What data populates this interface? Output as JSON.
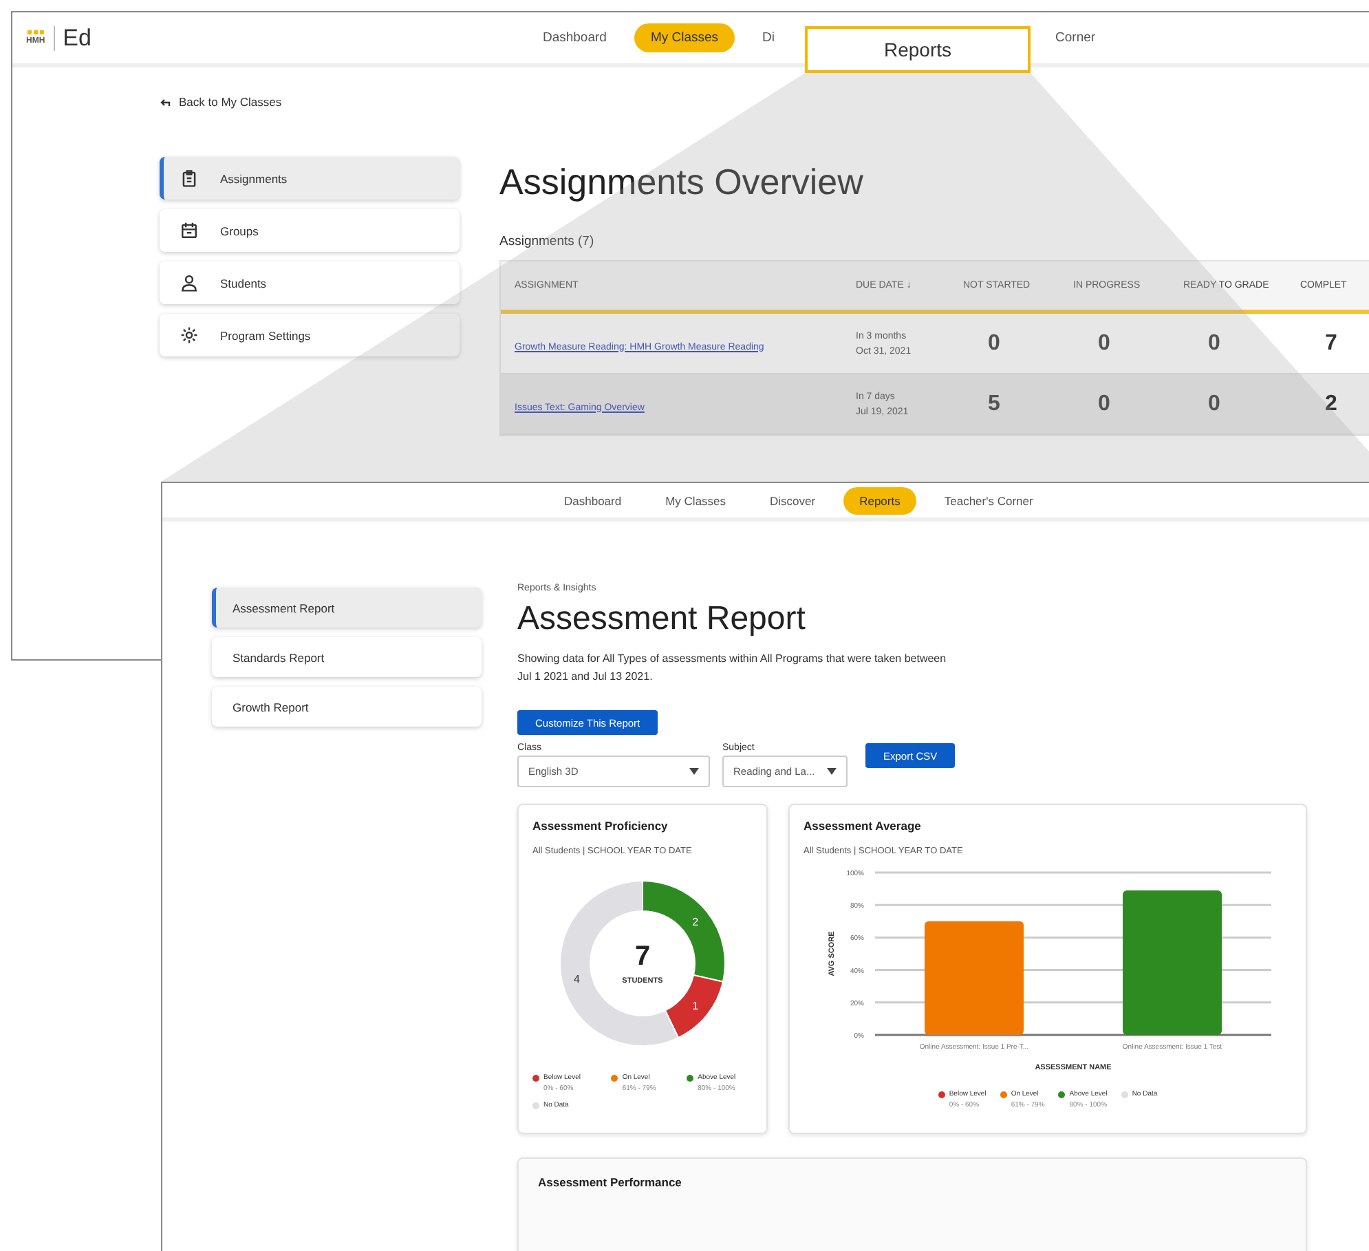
{
  "back_window": {
    "logo_mark": "HMH",
    "logo": "Ed",
    "nav": [
      {
        "label": "Dashboard",
        "selected": false
      },
      {
        "label": "My Classes",
        "selected": true
      },
      {
        "label": "Di",
        "selected": false
      },
      {
        "label": "Corner",
        "selected": false
      }
    ],
    "back_link": "Back to My Classes",
    "side_menu": [
      {
        "label": "Assignments",
        "selected": true
      },
      {
        "label": "Groups",
        "selected": false
      },
      {
        "label": "Students",
        "selected": false
      },
      {
        "label": "Program Settings",
        "selected": false
      }
    ],
    "title": "Assignments Overview",
    "subtitle": "Assignments (7)",
    "table": {
      "columns": [
        "ASSIGNMENT",
        "DUE DATE ↓",
        "NOT STARTED",
        "IN PROGRESS",
        "READY TO GRADE",
        "COMPLET"
      ],
      "rows": [
        {
          "assignment": "Growth Measure Reading: HMH Growth Measure Reading",
          "due_relative": "In 3 months",
          "due_date": "Oct 31, 2021",
          "counts": [
            "0",
            "0",
            "0",
            "7"
          ],
          "selected": false
        },
        {
          "assignment": "Issues Text: Gaming Overview",
          "due_relative": "In 7 days",
          "due_date": "Jul 19, 2021",
          "counts": [
            "5",
            "0",
            "0",
            "2"
          ],
          "selected": true
        }
      ]
    }
  },
  "callout": {
    "label": "Reports"
  },
  "front_window": {
    "nav": [
      {
        "label": "Dashboard",
        "selected": false
      },
      {
        "label": "My Classes",
        "selected": false
      },
      {
        "label": "Discover",
        "selected": false
      },
      {
        "label": "Reports",
        "selected": true
      },
      {
        "label": "Teacher's Corner",
        "selected": false
      }
    ],
    "sidebar": [
      {
        "label": "Assessment Report",
        "selected": true
      },
      {
        "label": "Standards Report",
        "selected": false
      },
      {
        "label": "Growth Report",
        "selected": false
      }
    ],
    "breadcrumb": "Reports & Insights",
    "title": "Assessment Report",
    "description": "Showing data for All Types of assessments within All Programs that were taken between Jul 1 2021 and Jul 13 2021.",
    "customize_button": "Customize This Report",
    "filters": [
      {
        "label": "Class",
        "value": "English 3D"
      },
      {
        "label": "Subject",
        "value": "Reading and La..."
      }
    ],
    "export_button": "Export CSV",
    "proficiency": {
      "title": "Assessment Proficiency",
      "subtitle": "All Students | SCHOOL YEAR TO DATE",
      "center_value": "7",
      "center_label": "STUDENTS",
      "chart_data": {
        "type": "donut",
        "values": [
          2,
          1,
          4
        ],
        "colors": [
          "#2e8b22",
          "#d32f2f",
          "#dedee3"
        ],
        "data_labels": true
      },
      "legend": [
        {
          "label": "Below Level",
          "range": "0% - 60%",
          "color": "#d32f2f"
        },
        {
          "label": "On Level",
          "range": "61% - 79%",
          "color": "#f07800"
        },
        {
          "label": "Above Level",
          "range": "80% - 100%",
          "color": "#2e8b22"
        },
        {
          "label": "No Data",
          "color": "#dedee3"
        }
      ]
    },
    "average": {
      "title": "Assessment Average",
      "subtitle": "All Students | SCHOOL YEAR TO DATE",
      "chart_data": {
        "type": "bar",
        "xlabel": "ASSESSMENT NAME",
        "ylabel": "AVG SCORE",
        "categories": [
          "Online Assessment: Issue 1 Pre-T...",
          "Online Assessment: Issue 1 Test"
        ],
        "values": [
          70,
          89
        ],
        "colors": [
          "#f07800",
          "#2e8b22"
        ],
        "ylim": [
          0,
          100
        ],
        "grid": true,
        "yticks": [
          {
            "value": 0,
            "label": "0%"
          },
          {
            "value": 20,
            "label": "20%"
          },
          {
            "value": 40,
            "label": "40%"
          },
          {
            "value": 60,
            "label": "60%"
          },
          {
            "value": 80,
            "label": "80%"
          },
          {
            "value": 100,
            "label": "100%"
          }
        ]
      },
      "legend": [
        {
          "label": "Below Level",
          "range": "0% - 60%",
          "color": "#d32f2f"
        },
        {
          "label": "On Level",
          "range": "61% - 79%",
          "color": "#f07800"
        },
        {
          "label": "Above Level",
          "range": "80% - 100%",
          "color": "#2e8b22"
        },
        {
          "label": "No Data",
          "color": "#dedee3"
        }
      ]
    },
    "performance": {
      "title": "Assessment Performance"
    }
  }
}
